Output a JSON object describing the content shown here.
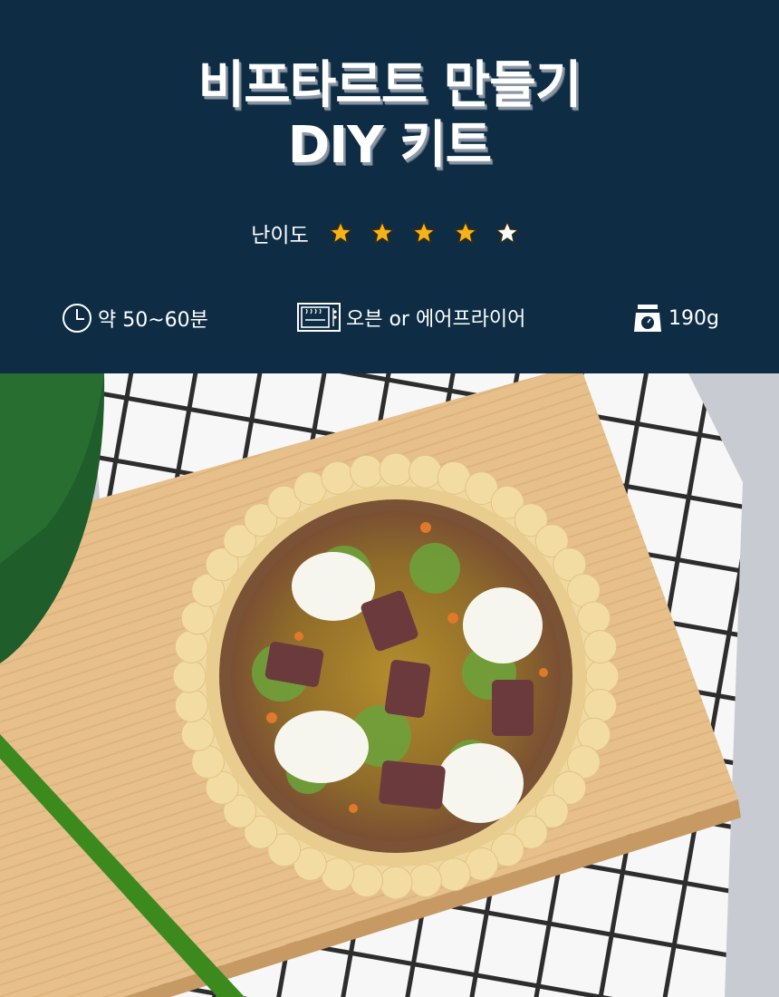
{
  "title": {
    "line1": "비프타르트 만들기",
    "line2": "DIY 키트"
  },
  "difficulty": {
    "label": "난이도",
    "rating": 4,
    "max": 5,
    "star_color": "#f6b318",
    "empty_star_color": "#ffffff"
  },
  "info": {
    "time": {
      "icon": "clock-icon",
      "text": "약 50~60분"
    },
    "cooking": {
      "icon": "microwave-oven-icon",
      "text": "오븐 or 에어프라이어"
    },
    "weight": {
      "icon": "kitchen-scale-icon",
      "text": "190g"
    }
  },
  "photo": {
    "icon": "beef-tart-photo",
    "colors": {
      "header_bg": "#0e2d45",
      "board": "#e7c18d",
      "crust": "#f2dca1",
      "filling": "#8a5a38"
    }
  }
}
